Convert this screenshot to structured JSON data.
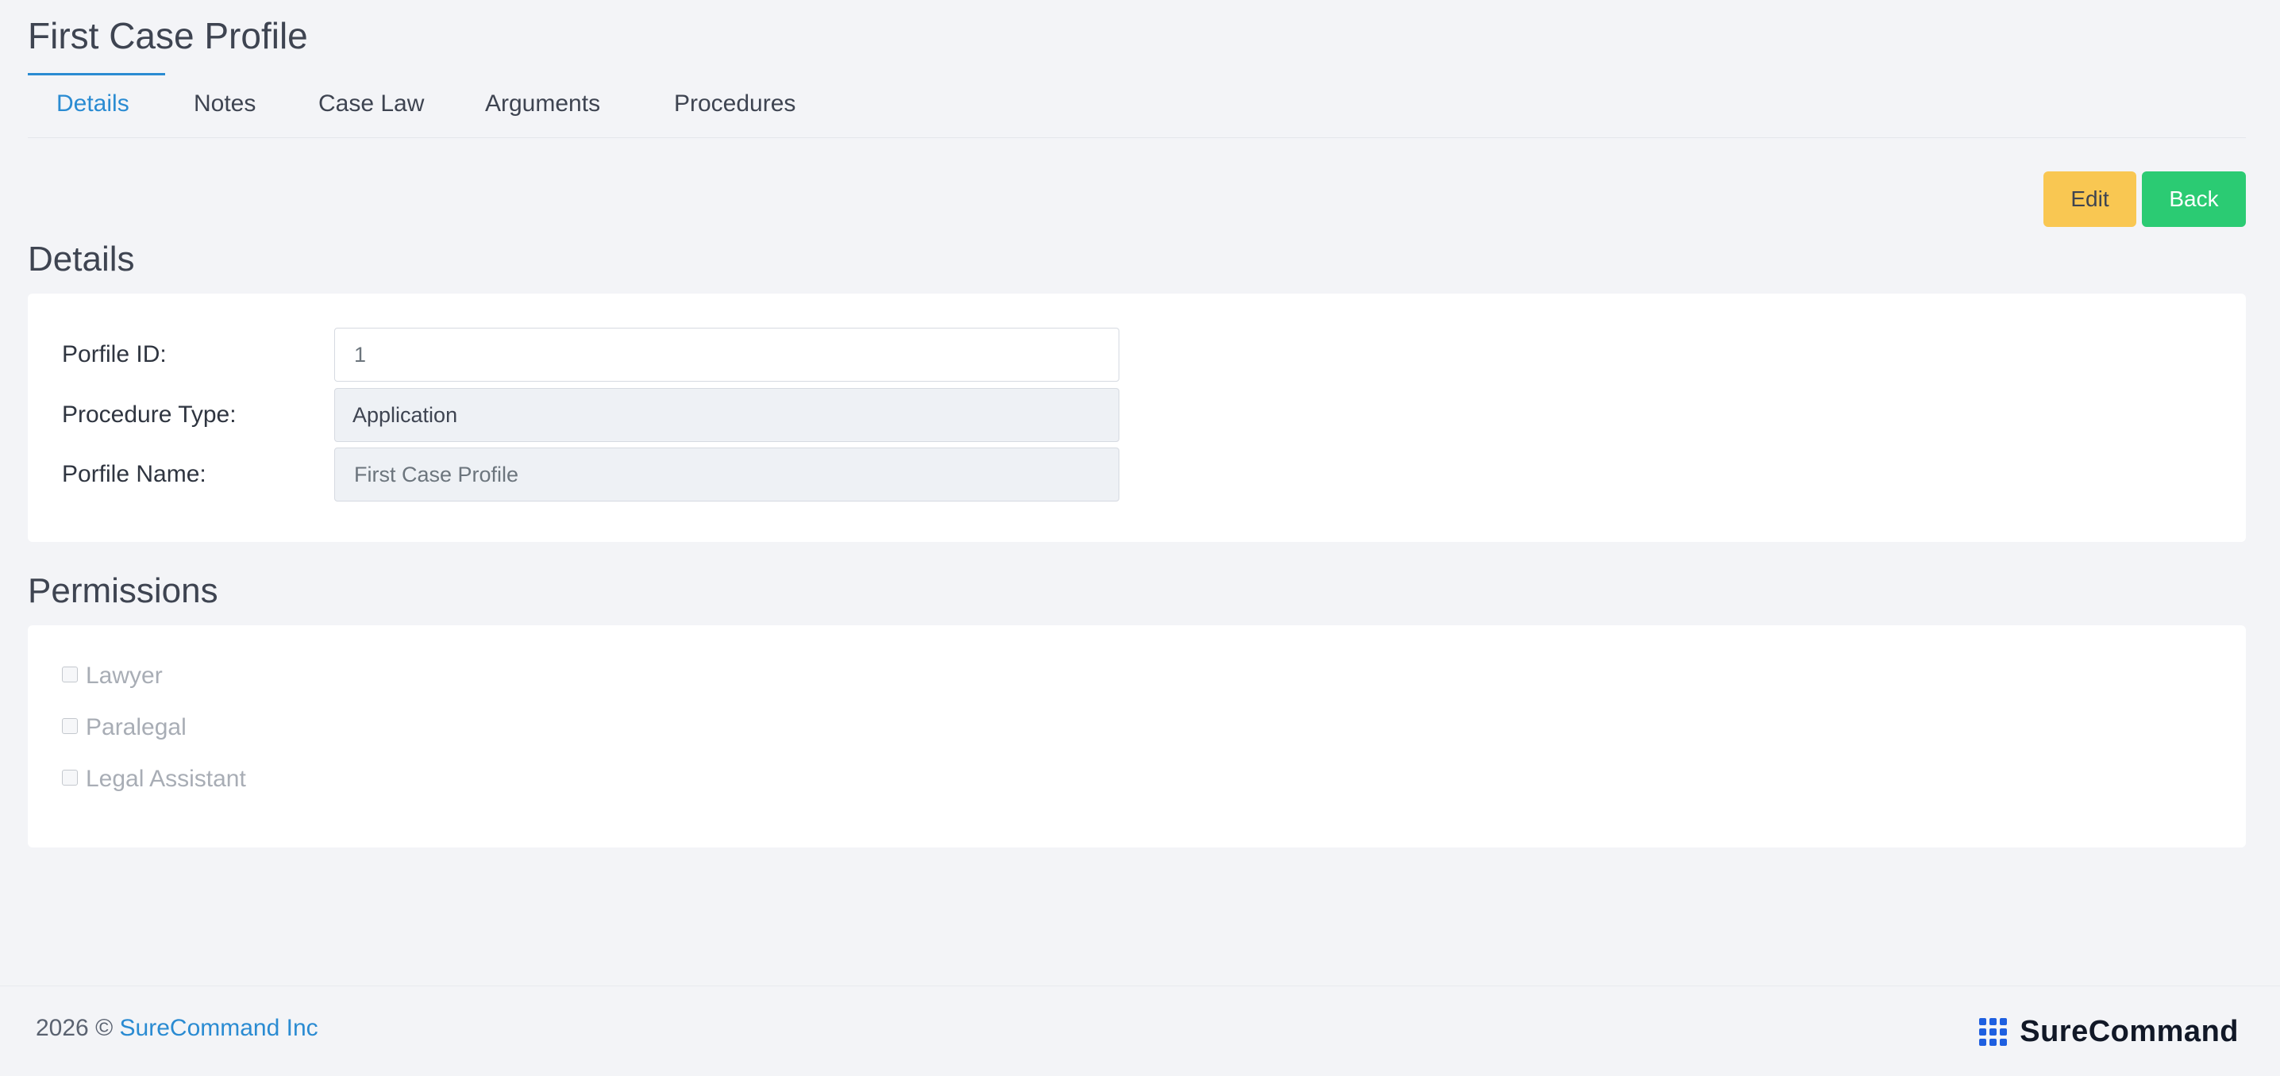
{
  "header": {
    "title": "First Case Profile"
  },
  "tabs": [
    {
      "label": "Details",
      "active": true
    },
    {
      "label": "Notes",
      "active": false
    },
    {
      "label": "Case Law",
      "active": false
    },
    {
      "label": "Arguments",
      "active": false
    },
    {
      "label": "Procedures",
      "active": false
    }
  ],
  "actions": {
    "edit_label": "Edit",
    "back_label": "Back"
  },
  "details": {
    "section_title": "Details",
    "fields": [
      {
        "label": "Porfile ID:",
        "value": "1"
      },
      {
        "label": "Procedure Type:",
        "value": "Application"
      },
      {
        "label": "Porfile Name:",
        "value": "First Case Profile"
      }
    ]
  },
  "permissions": {
    "section_title": "Permissions",
    "items": [
      {
        "label": "Lawyer",
        "checked": false
      },
      {
        "label": "Paralegal",
        "checked": false
      },
      {
        "label": "Legal Assistant",
        "checked": false
      }
    ]
  },
  "footer": {
    "copyright": "2026 ©",
    "company_link": "SureCommand Inc",
    "brand_name": "SureCommand",
    "brand_icon": "grid-logo-icon"
  },
  "colors": {
    "accent": "#2a8bd2",
    "edit_button": "#f9c752",
    "back_button": "#2bcb73",
    "brand_blue": "#1e5fe0"
  }
}
